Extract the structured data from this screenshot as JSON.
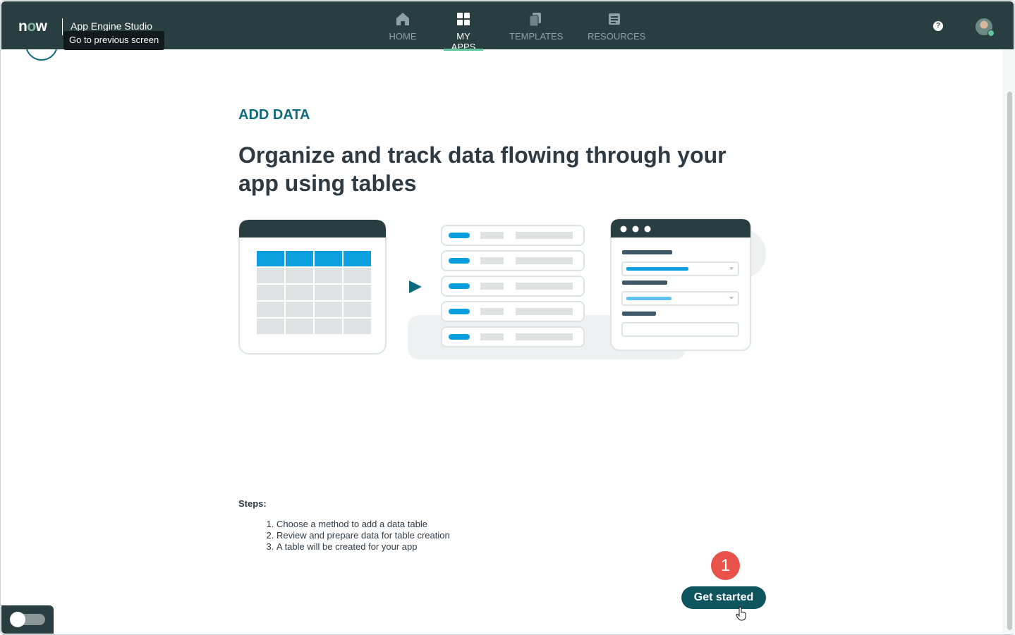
{
  "header": {
    "logo": {
      "pre": "n",
      "o": "o",
      "post": "w"
    },
    "app_title": "App Engine Studio",
    "tooltip": "Go to previous screen",
    "nav": [
      {
        "label": "HOME",
        "icon": "home-icon",
        "active": false
      },
      {
        "label": "MY APPS",
        "icon": "grid-icon",
        "active": true
      },
      {
        "label": "TEMPLATES",
        "icon": "copy-icon",
        "active": false
      },
      {
        "label": "RESOURCES",
        "icon": "document-icon",
        "active": false
      }
    ],
    "help_glyph": "?"
  },
  "main": {
    "eyebrow": "ADD DATA",
    "headline": "Organize and track data flowing through your app using tables",
    "steps_title": "Steps:",
    "steps": [
      "Choose a method to add a data table",
      "Review and prepare data for table creation",
      "A table will be created for your app"
    ],
    "badge": "1",
    "cta_label": "Get started"
  },
  "colors": {
    "topbar": "#293e40",
    "accent_teal": "#0e6a7d",
    "active_underline": "#62c39c",
    "cta": "#0e5560",
    "badge": "#e8524a",
    "illustration_blue": "#0b9fdf"
  }
}
